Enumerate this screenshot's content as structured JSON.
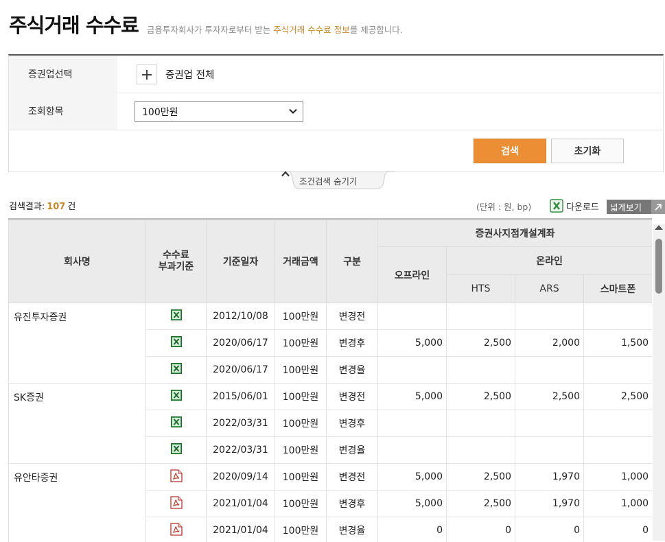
{
  "header": {
    "title": "주식거래 수수료",
    "subtitle_pre": "금융투자회사가 투자자로부터 받는 ",
    "subtitle_hl": "주식거래 수수료 정보",
    "subtitle_post": "를 제공합니다."
  },
  "filters": {
    "broker_label": "증권업선택",
    "broker_value": "증권업 전체",
    "item_label": "조회항목",
    "item_value": "100만원",
    "search_button": "검색",
    "reset_button": "초기화",
    "toggle_label": "조건검색 숨기기"
  },
  "results": {
    "label": "검색결과:",
    "count": "107",
    "unit_suffix": "건",
    "unit_note": "(단위 : 원, bp)",
    "download_label": "다운로드",
    "wide_label": "넓게보기"
  },
  "table": {
    "headers": {
      "company": "회사명",
      "fee_basis_1": "수수료",
      "fee_basis_2": "부과기준",
      "date": "기준일자",
      "amount": "거래금액",
      "kind": "구분",
      "branch": "증권사지점개설계좌",
      "offline": "오프라인",
      "online": "온라인",
      "hts": "HTS",
      "ars": "ARS",
      "smartphone": "스마트폰"
    },
    "groups": [
      {
        "company": "유진투자증권",
        "icon": "excel-icon",
        "rows": [
          {
            "date": "2012/10/08",
            "amount": "100만원",
            "kind": "변경전",
            "offline": "",
            "hts": "",
            "ars": "",
            "smart": ""
          },
          {
            "date": "2020/06/17",
            "amount": "100만원",
            "kind": "변경후",
            "offline": "5,000",
            "hts": "2,500",
            "ars": "2,000",
            "smart": "1,500"
          },
          {
            "date": "2020/06/17",
            "amount": "100만원",
            "kind": "변경율",
            "offline": "",
            "hts": "",
            "ars": "",
            "smart": ""
          }
        ]
      },
      {
        "company": "SK증권",
        "icon": "excel-icon",
        "rows": [
          {
            "date": "2015/06/01",
            "amount": "100만원",
            "kind": "변경전",
            "offline": "5,000",
            "hts": "2,500",
            "ars": "2,500",
            "smart": "2,500"
          },
          {
            "date": "2022/03/31",
            "amount": "100만원",
            "kind": "변경후",
            "offline": "",
            "hts": "",
            "ars": "",
            "smart": ""
          },
          {
            "date": "2022/03/31",
            "amount": "100만원",
            "kind": "변경율",
            "offline": "",
            "hts": "",
            "ars": "",
            "smart": ""
          }
        ]
      },
      {
        "company": "유안타증권",
        "icon": "pdf-icon",
        "rows": [
          {
            "date": "2020/09/14",
            "amount": "100만원",
            "kind": "변경전",
            "offline": "5,000",
            "hts": "2,500",
            "ars": "1,970",
            "smart": "1,000"
          },
          {
            "date": "2021/01/04",
            "amount": "100만원",
            "kind": "변경후",
            "offline": "5,000",
            "hts": "2,500",
            "ars": "1,970",
            "smart": "1,000"
          },
          {
            "date": "2021/01/04",
            "amount": "100만원",
            "kind": "변경율",
            "offline": "0",
            "hts": "0",
            "ars": "0",
            "smart": "0"
          }
        ]
      }
    ]
  },
  "colors": {
    "accent_orange": "#ec8f34",
    "highlight_text": "#c8892a",
    "header_bg": "#ebebeb"
  }
}
